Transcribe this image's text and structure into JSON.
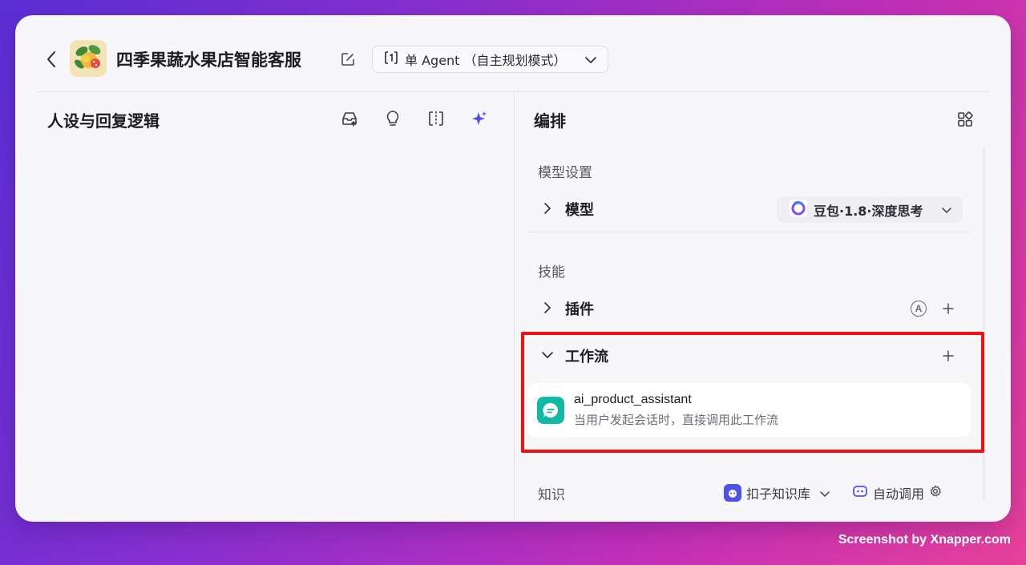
{
  "header": {
    "title": "四季果蔬水果店智能客服",
    "mode": {
      "label": "单 Agent （自主规划模式）"
    }
  },
  "left_panel": {
    "title": "人设与回复逻辑"
  },
  "right_panel": {
    "title": "编排",
    "model_section": {
      "label": "模型设置",
      "row_label": "模型",
      "selected_model": "豆包·1.8·深度思考"
    },
    "skills_section": {
      "label": "技能",
      "plugins_label": "插件",
      "auto_badge": "A",
      "workflow_label": "工作流",
      "workflows": [
        {
          "name": "ai_product_assistant",
          "description": "当用户发起会话时，直接调用此工作流"
        }
      ]
    },
    "knowledge_section": {
      "label": "知识",
      "source": "扣子知识库",
      "invoke_mode": "自动调用"
    }
  },
  "watermark": "Screenshot by Xnapper.com",
  "colors": {
    "accent": "#4d53e8",
    "highlight": "#f50f0f",
    "workflow_icon": "#12b8a6"
  }
}
